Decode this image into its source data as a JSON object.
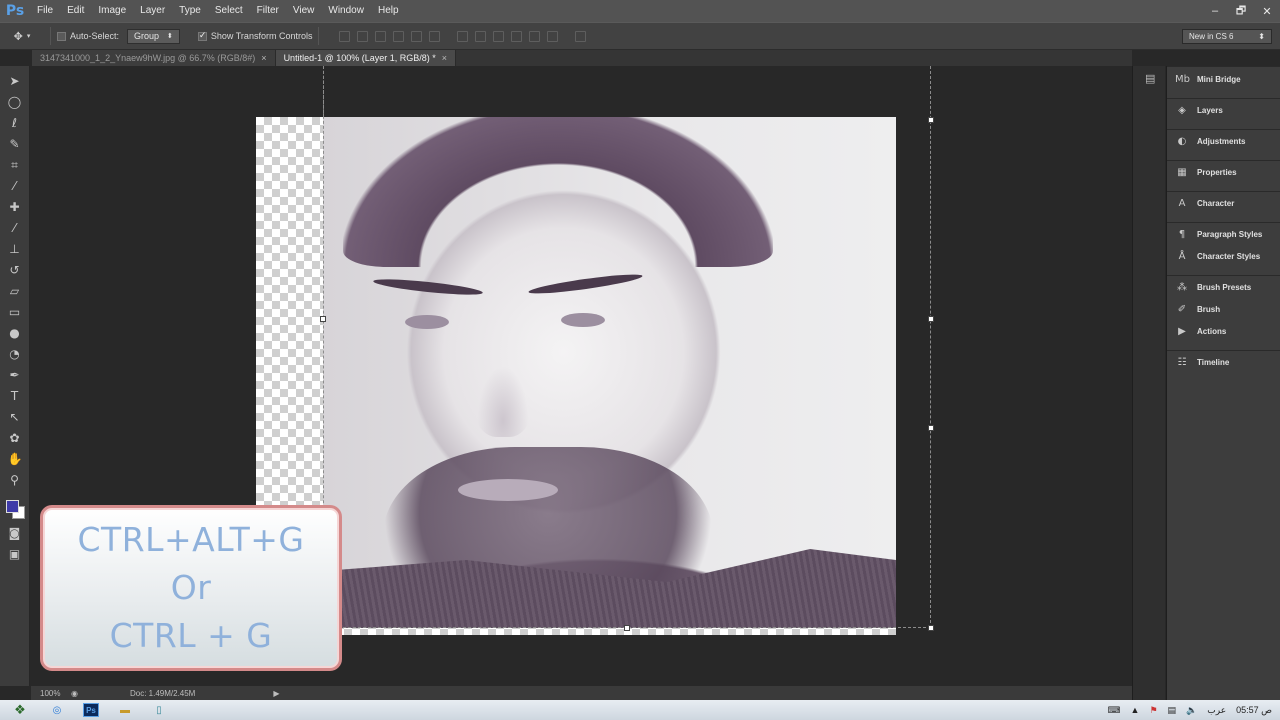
{
  "app": {
    "logo": "Ps",
    "menu": [
      "File",
      "Edit",
      "Image",
      "Layer",
      "Type",
      "Select",
      "Filter",
      "View",
      "Window",
      "Help"
    ],
    "window_controls": [
      "–",
      "🗗",
      "✕"
    ]
  },
  "options": {
    "auto_select_label": "Auto-Select:",
    "auto_select_checked": false,
    "group_value": "Group",
    "show_transform_label": "Show Transform Controls",
    "show_transform_checked": true,
    "workspace": "New in CS 6"
  },
  "tabs": [
    {
      "label": "3147341000_1_2_Ynaew9hW.jpg @ 66.7% (RGB/8#)",
      "active": false
    },
    {
      "label": "Untitled-1 @ 100% (Layer 1, RGB/8) *",
      "active": true
    }
  ],
  "tools": [
    "move-icon",
    "marquee-icon",
    "lasso-icon",
    "quick-select-icon",
    "crop-icon",
    "eyedropper-icon",
    "healing-icon",
    "brush-icon",
    "stamp-icon",
    "history-brush-icon",
    "eraser-icon",
    "gradient-icon",
    "blur-icon",
    "dodge-icon",
    "pen-icon",
    "type-icon",
    "path-select-icon",
    "shape-icon",
    "hand-icon",
    "zoom-icon"
  ],
  "colors": {
    "foreground": "#3e3aa8",
    "background": "#ffffff",
    "overlay_text": "#8fb1db",
    "overlay_border": "#d48a8a"
  },
  "overlay": {
    "line1": "CTRL+ALT+G",
    "line2": "Or",
    "line3": "CTRL + G"
  },
  "status": {
    "zoom": "100%",
    "doc": "Doc: 1.49M/2.45M"
  },
  "panels": [
    {
      "label": "Mini Bridge",
      "icon": "mini-bridge-icon"
    },
    {
      "label": "Layers",
      "icon": "layers-icon"
    },
    {
      "label": "Adjustments",
      "icon": "adjustments-icon"
    },
    {
      "label": "Properties",
      "icon": "properties-icon"
    },
    {
      "label": "Character",
      "icon": "character-icon"
    },
    {
      "label": "Paragraph Styles",
      "icon": "paragraph-styles-icon"
    },
    {
      "label": "Character Styles",
      "icon": "character-styles-icon"
    },
    {
      "label": "Brush Presets",
      "icon": "brush-presets-icon"
    },
    {
      "label": "Brush",
      "icon": "brush-panel-icon"
    },
    {
      "label": "Actions",
      "icon": "actions-icon"
    },
    {
      "label": "Timeline",
      "icon": "timeline-icon"
    }
  ],
  "taskbar": {
    "clock": "05:57 ص",
    "language": "عرب"
  }
}
